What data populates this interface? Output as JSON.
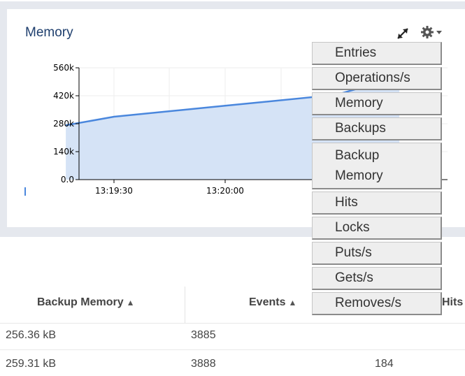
{
  "panel": {
    "title": "Memory"
  },
  "chart_data": {
    "type": "area",
    "title": "Memory",
    "y_ticks": [
      "560k",
      "420k",
      "280k",
      "140k",
      "0.0"
    ],
    "y_tick_values": [
      560000,
      420000,
      280000,
      140000,
      0
    ],
    "ylim": [
      0,
      560000
    ],
    "x_ticks": [
      "13:19:30",
      "13:20:00"
    ],
    "x": [
      "13:19:17",
      "13:19:30",
      "13:20:00",
      "13:20:30",
      "13:20:47"
    ],
    "series": [
      {
        "values": [
          272000,
          315000,
          370000,
          425000,
          515000
        ]
      }
    ],
    "grid": true,
    "colors": {
      "line": "#4a87dd",
      "fill": "#d5e3f6"
    }
  },
  "menu": {
    "items": [
      "Entries",
      "Operations/s",
      "Memory",
      "Backups",
      "Backup Memory",
      "Hits",
      "Locks",
      "Puts/s",
      "Gets/s",
      "Removes/s"
    ]
  },
  "table": {
    "headers": [
      "Backup Memory",
      "Events",
      "Hits"
    ],
    "rows": [
      [
        "256.36 kB",
        "3885",
        ""
      ],
      [
        "259.31 kB",
        "3888",
        "184"
      ]
    ]
  },
  "colors": {
    "panel_bg": "#e5e8ee",
    "title": "#1f3f6e",
    "menu_bg": "#eeeeee"
  }
}
